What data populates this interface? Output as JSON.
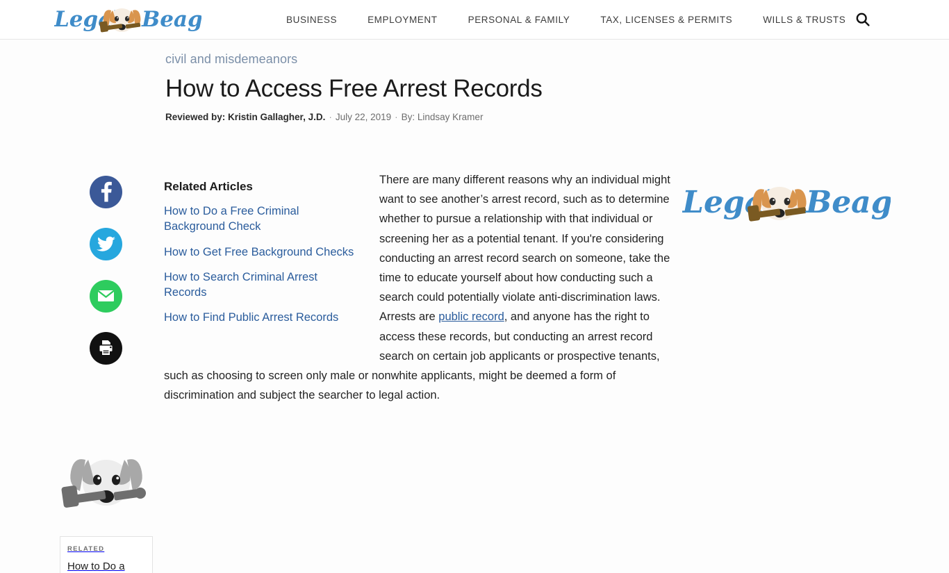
{
  "header": {
    "logo_text": "Legal Beagle",
    "logo_word_1": "Legal",
    "logo_word_2": "Beagle",
    "nav": [
      {
        "label": "BUSINESS",
        "name": "nav-business"
      },
      {
        "label": "EMPLOYMENT",
        "name": "nav-employment"
      },
      {
        "label": "PERSONAL & FAMILY",
        "name": "nav-personal-family"
      },
      {
        "label": "TAX, LICENSES & PERMITS",
        "name": "nav-tax-licenses-permits"
      },
      {
        "label": "WILLS & TRUSTS",
        "name": "nav-wills-trusts"
      }
    ],
    "search_icon": "search-icon"
  },
  "article": {
    "breadcrumb": "civil and misdemeanors",
    "title": "How to Access Free Arrest Records",
    "reviewed_by": "Reviewed by: Kristin Gallagher, J.D.",
    "separator": "·",
    "date": "July 22, 2019",
    "author": "By: Lindsay Kramer",
    "body_part_1": "There are many different reasons why an individual might want to see another’s arrest record, such as to determine whether to pursue a relationship with that individual or screening her as a potential tenant. If you're considering conducting an arrest record search on someone, take the time to educate yourself about how conducting such a search could potentially violate anti-discrimination laws. Arrests are ",
    "body_link": "public record",
    "body_part_2": ", and anyone has the right to access these records, but conducting an arrest record search on certain job applicants or prospective tenants, such as choosing to screen only male or nonwhite applicants, might be deemed a form of discrimination and subject the searcher to legal action."
  },
  "share": {
    "items": [
      {
        "name": "share-facebook-button",
        "icon": "facebook-icon",
        "label": "Facebook",
        "color": "#3b5998"
      },
      {
        "name": "share-twitter-button",
        "icon": "twitter-icon",
        "label": "Twitter",
        "color": "#26a7de"
      },
      {
        "name": "share-email-button",
        "icon": "email-icon",
        "label": "Email",
        "color": "#2ecc5e"
      },
      {
        "name": "share-print-button",
        "icon": "print-icon",
        "label": "Print",
        "color": "#111111"
      }
    ]
  },
  "related": {
    "heading": "Related Articles",
    "links": [
      "How to Do a Free Criminal Background Check",
      "How to Get Free Background Checks",
      "How to Search Criminal Arrest Records",
      "How to Find Public Arrest Records"
    ]
  },
  "related_card": {
    "kicker": "RELATED",
    "title": "How to Do a",
    "image": "beagle-gavel-grayscale-image"
  },
  "right_rail": {
    "logo_alt": "Legal Beagle",
    "logo_word_1": "Legal",
    "logo_word_2": "Beagle"
  },
  "colors": {
    "brand_blue": "#3f8cc9",
    "link_blue": "#2a5c9c",
    "breadcrumb_blue": "#7b8fa8",
    "page_bg": "#fdfdfd",
    "header_bg": "#ffffff"
  }
}
